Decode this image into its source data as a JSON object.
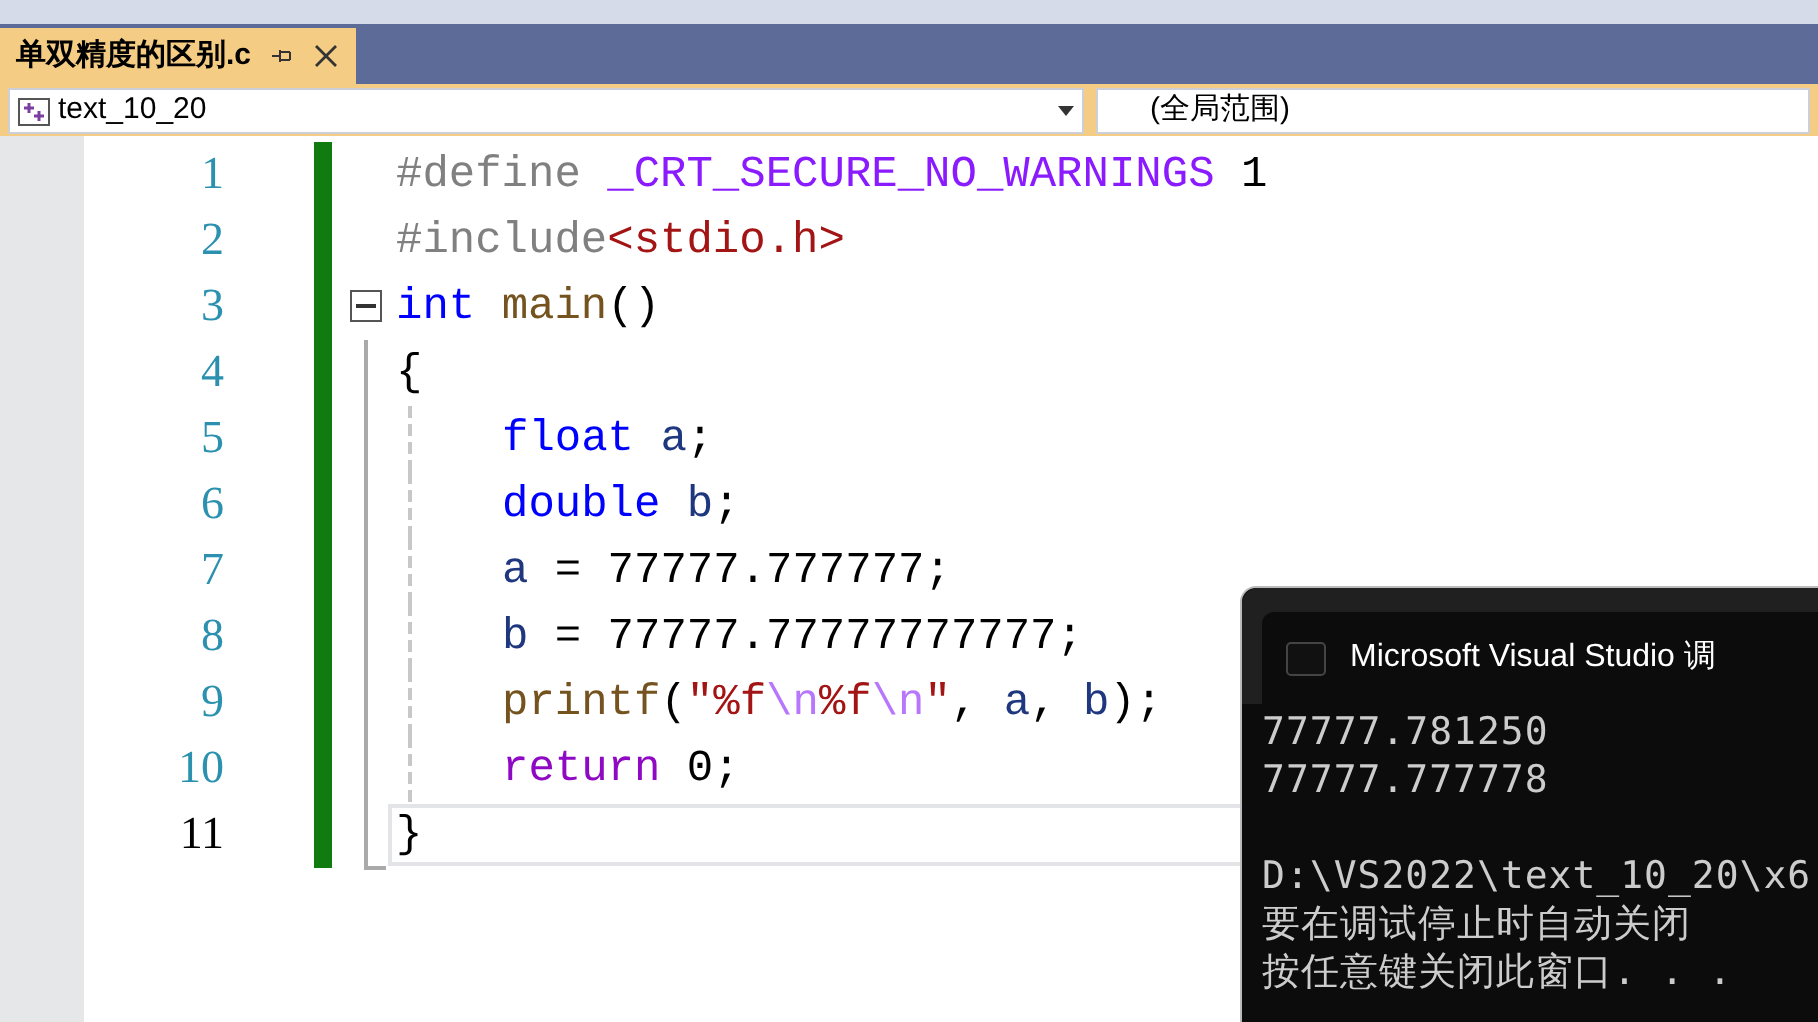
{
  "tab": {
    "title": "单双精度的区别.c",
    "selected": true
  },
  "navigation": {
    "project": "text_10_20",
    "scope": "(全局范围)"
  },
  "editor": {
    "lines": [
      {
        "number": "1",
        "current": false,
        "indented": false,
        "tokens": [
          {
            "kind": "pre",
            "text": "#define "
          },
          {
            "kind": "macro",
            "text": "_CRT_SECURE_NO_WARNINGS"
          },
          {
            "kind": "plain",
            "text": " 1"
          }
        ]
      },
      {
        "number": "2",
        "current": false,
        "indented": false,
        "tokens": [
          {
            "kind": "pre",
            "text": "#include"
          },
          {
            "kind": "string",
            "text": "<stdio.h>"
          }
        ]
      },
      {
        "number": "3",
        "current": false,
        "indented": false,
        "tokens": [
          {
            "kind": "keyword",
            "text": "int "
          },
          {
            "kind": "function",
            "text": "main"
          },
          {
            "kind": "plain",
            "text": "()"
          }
        ]
      },
      {
        "number": "4",
        "current": false,
        "indented": false,
        "tokens": [
          {
            "kind": "plain",
            "text": "{"
          }
        ]
      },
      {
        "number": "5",
        "current": false,
        "indented": true,
        "tokens": [
          {
            "kind": "keyword",
            "text": "float"
          },
          {
            "kind": "variable",
            "text": " a"
          },
          {
            "kind": "plain",
            "text": ";"
          }
        ]
      },
      {
        "number": "6",
        "current": false,
        "indented": true,
        "tokens": [
          {
            "kind": "keyword",
            "text": "double"
          },
          {
            "kind": "variable",
            "text": " b"
          },
          {
            "kind": "plain",
            "text": ";"
          }
        ]
      },
      {
        "number": "7",
        "current": false,
        "indented": true,
        "tokens": [
          {
            "kind": "variable",
            "text": "a"
          },
          {
            "kind": "plain",
            "text": " = 77777.777777;"
          }
        ]
      },
      {
        "number": "8",
        "current": false,
        "indented": true,
        "tokens": [
          {
            "kind": "variable",
            "text": "b"
          },
          {
            "kind": "plain",
            "text": " = 77777.77777777777;"
          }
        ]
      },
      {
        "number": "9",
        "current": false,
        "indented": true,
        "tokens": [
          {
            "kind": "function",
            "text": "printf"
          },
          {
            "kind": "plain",
            "text": "("
          },
          {
            "kind": "string",
            "text": "\"%f"
          },
          {
            "kind": "escape",
            "text": "\\n"
          },
          {
            "kind": "string",
            "text": "%f"
          },
          {
            "kind": "escape",
            "text": "\\n"
          },
          {
            "kind": "string",
            "text": "\""
          },
          {
            "kind": "plain",
            "text": ", "
          },
          {
            "kind": "variable",
            "text": "a"
          },
          {
            "kind": "plain",
            "text": ", "
          },
          {
            "kind": "variable",
            "text": "b"
          },
          {
            "kind": "plain",
            "text": ");"
          }
        ]
      },
      {
        "number": "10",
        "current": false,
        "indented": true,
        "tokens": [
          {
            "kind": "control",
            "text": "return"
          },
          {
            "kind": "plain",
            "text": " 0;"
          }
        ]
      },
      {
        "number": "11",
        "current": true,
        "indented": false,
        "tokens": [
          {
            "kind": "plain",
            "text": "}"
          }
        ]
      }
    ]
  },
  "console": {
    "title": "Microsoft Visual Studio 调",
    "output": [
      "77777.781250",
      "77777.777778"
    ],
    "messages": [
      "D:\\VS2022\\text_10_20\\x6",
      "要在调试停止时自动关闭",
      "按任意键关闭此窗口. . ."
    ]
  }
}
